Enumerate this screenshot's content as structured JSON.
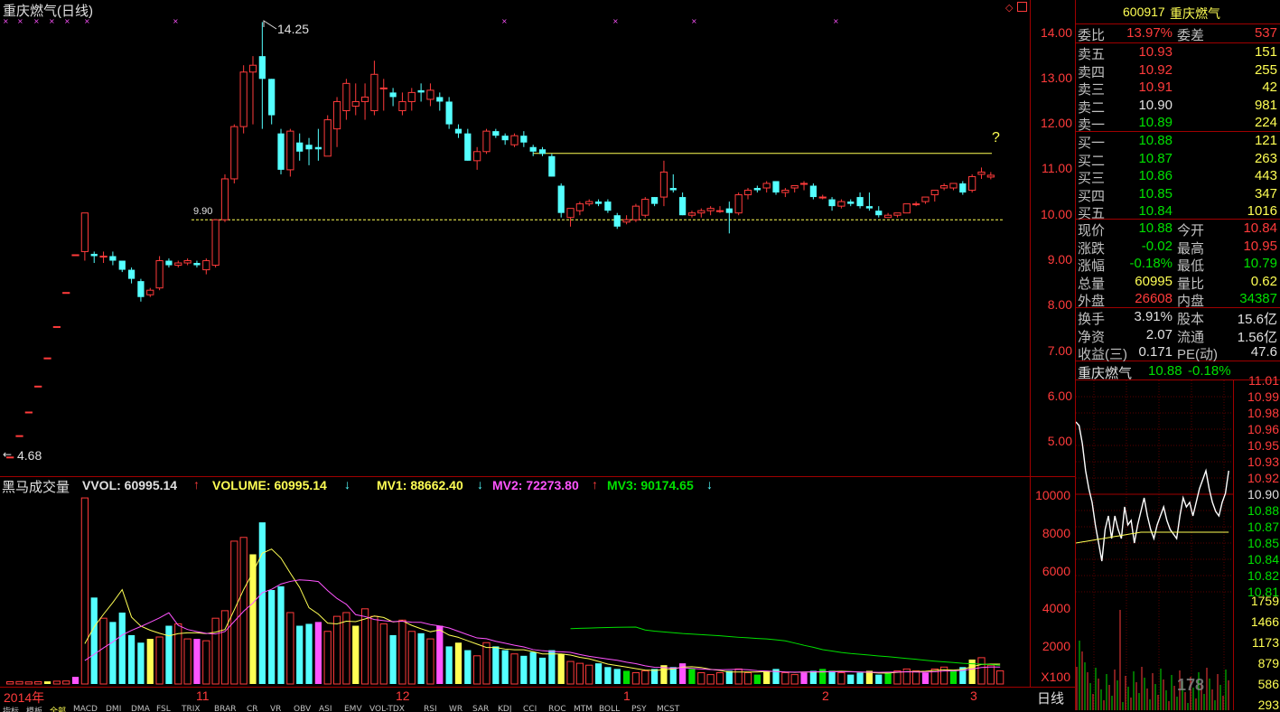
{
  "title": "重庆燃气(日线)",
  "stock": {
    "code": "600917",
    "name": "重庆燃气"
  },
  "kline_axis": [
    "14.00",
    "13.00",
    "12.00",
    "11.00",
    "10.00",
    "9.00",
    "8.00",
    "7.00",
    "6.00",
    "5.00"
  ],
  "annotations": {
    "high": "14.25",
    "low": "4.68",
    "support": "9.90",
    "question": "?"
  },
  "indicator": {
    "name": "黑马成交量",
    "vvol": "VVOL: 60995.14",
    "volume": "VOLUME: 60995.14",
    "mv1": "MV1: 88662.40",
    "mv2": "MV2: 72273.80",
    "mv3": "MV3: 90174.65",
    "arrow_up": "↑",
    "arrow_down": "↓"
  },
  "vol_axis": [
    "10000",
    "8000",
    "6000",
    "4000",
    "2000"
  ],
  "vol_unit": "X100",
  "date_axis": {
    "year": "2014年",
    "months": [
      "11",
      "12",
      "1",
      "2",
      "3"
    ],
    "period": "日线"
  },
  "bottom_tabs": [
    "指标",
    "模板",
    "全部",
    "MACD",
    "DMI",
    "DMA",
    "FSL",
    "TRIX",
    "BRAR",
    "CR",
    "VR",
    "OBV",
    "ASI",
    "EMV",
    "VOL-TDX",
    "RSI",
    "WR",
    "SAR",
    "KDJ",
    "CCI",
    "ROC",
    "MTM",
    "BOLL",
    "PSY",
    "MCST"
  ],
  "quote": {
    "weibi": {
      "label": "委比",
      "value": "13.97%",
      "label2": "委差",
      "value2": "537"
    },
    "sells": [
      {
        "label": "卖五",
        "price": "10.93",
        "vol": "151"
      },
      {
        "label": "卖四",
        "price": "10.92",
        "vol": "255"
      },
      {
        "label": "卖三",
        "price": "10.91",
        "vol": "42"
      },
      {
        "label": "卖二",
        "price": "10.90",
        "vol": "981"
      },
      {
        "label": "卖一",
        "price": "10.89",
        "vol": "224"
      }
    ],
    "buys": [
      {
        "label": "买一",
        "price": "10.88",
        "vol": "121"
      },
      {
        "label": "买二",
        "price": "10.87",
        "vol": "263"
      },
      {
        "label": "买三",
        "price": "10.86",
        "vol": "443"
      },
      {
        "label": "买四",
        "price": "10.85",
        "vol": "347"
      },
      {
        "label": "买五",
        "price": "10.84",
        "vol": "1016"
      }
    ],
    "stats": [
      {
        "l1": "现价",
        "v1": "10.88",
        "l2": "今开",
        "v2": "10.84"
      },
      {
        "l1": "涨跌",
        "v1": "-0.02",
        "l2": "最高",
        "v2": "10.95"
      },
      {
        "l1": "涨幅",
        "v1": "-0.18%",
        "l2": "最低",
        "v2": "10.79"
      },
      {
        "l1": "总量",
        "v1": "60995",
        "l2": "量比",
        "v2": "0.62"
      },
      {
        "l1": "外盘",
        "v1": "26608",
        "l2": "内盘",
        "v2": "34387"
      }
    ],
    "stats2": [
      {
        "l1": "换手",
        "v1": "3.91%",
        "l2": "股本",
        "v2": "15.6亿"
      },
      {
        "l1": "净资",
        "v1": "2.07",
        "l2": "流通",
        "v2": "1.56亿"
      },
      {
        "l1": "收益(三)",
        "v1": "0.171",
        "l2": "PE(动)",
        "v2": "47.6"
      }
    ]
  },
  "mini": {
    "name": "重庆燃气",
    "price": "10.88",
    "change": "-0.18%",
    "price_axis": [
      "11.01",
      "10.99",
      "10.98",
      "10.96",
      "10.95",
      "10.93",
      "10.92",
      "10.90",
      "10.88",
      "10.87",
      "10.85",
      "10.84",
      "10.82",
      "10.81"
    ],
    "vol_axis": [
      "1759",
      "1466",
      "1173",
      "879",
      "586",
      "293"
    ],
    "watermark": "178"
  },
  "colors": {
    "up": "#ff3b3b",
    "down": "#54ffff",
    "ma1": "#ffff54",
    "ma2": "#ff54ff",
    "ma3": "#00e000",
    "border": "#a00000"
  },
  "chart_data": {
    "type": "candlestick",
    "ylim": [
      4.5,
      14.5
    ],
    "candles": [
      [
        4.68,
        4.68,
        4.68,
        4.68
      ],
      [
        5.15,
        5.15,
        5.15,
        5.15
      ],
      [
        5.67,
        5.67,
        5.67,
        5.67
      ],
      [
        6.24,
        6.24,
        6.24,
        6.24
      ],
      [
        6.86,
        6.86,
        6.86,
        6.86
      ],
      [
        7.55,
        7.55,
        7.55,
        7.55
      ],
      [
        8.3,
        8.3,
        8.3,
        8.3
      ],
      [
        9.13,
        9.13,
        9.13,
        9.13
      ],
      [
        9.2,
        10.05,
        9.0,
        10.05
      ],
      [
        9.15,
        9.2,
        8.95,
        9.1
      ],
      [
        9.1,
        9.2,
        8.95,
        9.1
      ],
      [
        9.1,
        9.2,
        8.9,
        9.0
      ],
      [
        9.0,
        9.0,
        8.75,
        8.8
      ],
      [
        8.8,
        8.85,
        8.5,
        8.6
      ],
      [
        8.55,
        8.6,
        8.1,
        8.2
      ],
      [
        8.25,
        8.4,
        8.2,
        8.35
      ],
      [
        8.4,
        9.1,
        8.35,
        9.0
      ],
      [
        9.0,
        9.05,
        8.85,
        8.9
      ],
      [
        8.9,
        9.0,
        8.85,
        8.95
      ],
      [
        8.95,
        9.05,
        8.9,
        9.0
      ],
      [
        8.95,
        9.0,
        8.85,
        8.9
      ],
      [
        8.8,
        9.05,
        8.7,
        9.0
      ],
      [
        8.9,
        9.9,
        8.85,
        9.9
      ],
      [
        9.9,
        10.9,
        9.85,
        10.8
      ],
      [
        10.8,
        12.0,
        10.7,
        11.95
      ],
      [
        11.95,
        13.3,
        11.8,
        13.15
      ],
      [
        13.15,
        13.5,
        12.0,
        13.3
      ],
      [
        13.5,
        14.25,
        11.9,
        13.0
      ],
      [
        13.0,
        13.0,
        12.0,
        12.2
      ],
      [
        11.8,
        11.9,
        10.9,
        11.0
      ],
      [
        11.0,
        11.9,
        10.85,
        11.85
      ],
      [
        11.6,
        11.8,
        11.2,
        11.4
      ],
      [
        11.55,
        11.7,
        11.1,
        11.45
      ],
      [
        11.5,
        11.9,
        11.2,
        11.45
      ],
      [
        11.3,
        12.2,
        11.3,
        12.1
      ],
      [
        11.9,
        12.6,
        11.5,
        12.5
      ],
      [
        12.3,
        13.0,
        12.1,
        12.9
      ],
      [
        12.4,
        12.9,
        12.2,
        12.5
      ],
      [
        12.5,
        12.9,
        12.1,
        12.6
      ],
      [
        12.3,
        13.4,
        12.2,
        13.1
      ],
      [
        12.8,
        13.0,
        12.3,
        12.8
      ],
      [
        12.7,
        12.8,
        12.4,
        12.6
      ],
      [
        12.3,
        12.7,
        12.2,
        12.5
      ],
      [
        12.5,
        12.8,
        12.3,
        12.7
      ],
      [
        12.75,
        12.9,
        12.5,
        12.7
      ],
      [
        12.55,
        12.9,
        12.4,
        12.75
      ],
      [
        12.6,
        12.7,
        12.3,
        12.5
      ],
      [
        12.5,
        12.6,
        11.9,
        12.0
      ],
      [
        11.9,
        12.0,
        11.7,
        11.8
      ],
      [
        11.8,
        11.9,
        11.2,
        11.2
      ],
      [
        11.2,
        11.5,
        11.0,
        11.4
      ],
      [
        11.4,
        11.9,
        11.35,
        11.85
      ],
      [
        11.85,
        11.9,
        11.7,
        11.75
      ],
      [
        11.75,
        11.8,
        11.55,
        11.65
      ],
      [
        11.55,
        11.8,
        11.5,
        11.75
      ],
      [
        11.75,
        11.85,
        11.5,
        11.6
      ],
      [
        11.5,
        11.55,
        11.3,
        11.4
      ],
      [
        11.45,
        11.5,
        11.3,
        11.35
      ],
      [
        11.3,
        11.35,
        10.85,
        10.85
      ],
      [
        10.65,
        10.7,
        9.95,
        10.05
      ],
      [
        9.95,
        10.1,
        9.75,
        10.15
      ],
      [
        10.1,
        10.3,
        10.0,
        10.25
      ],
      [
        10.25,
        10.35,
        10.2,
        10.3
      ],
      [
        10.3,
        10.35,
        10.2,
        10.25
      ],
      [
        10.3,
        10.35,
        10.05,
        10.1
      ],
      [
        10.0,
        10.05,
        9.7,
        9.75
      ],
      [
        9.85,
        10.0,
        9.8,
        9.9
      ],
      [
        9.9,
        10.25,
        9.85,
        10.2
      ],
      [
        10.0,
        10.4,
        9.95,
        10.35
      ],
      [
        10.4,
        10.4,
        10.2,
        10.25
      ],
      [
        10.4,
        11.2,
        10.2,
        10.95
      ],
      [
        10.6,
        10.9,
        10.5,
        10.55
      ],
      [
        10.4,
        10.5,
        10.0,
        10.0
      ],
      [
        10.0,
        10.1,
        9.95,
        10.05
      ],
      [
        10.05,
        10.15,
        9.95,
        10.1
      ],
      [
        10.1,
        10.2,
        10.0,
        10.15
      ],
      [
        10.1,
        10.2,
        10.05,
        10.1
      ],
      [
        10.15,
        10.3,
        9.6,
        10.05
      ],
      [
        10.05,
        10.5,
        10.0,
        10.45
      ],
      [
        10.45,
        10.6,
        10.35,
        10.55
      ],
      [
        10.6,
        10.65,
        10.5,
        10.55
      ],
      [
        10.6,
        10.75,
        10.5,
        10.7
      ],
      [
        10.75,
        10.75,
        10.45,
        10.5
      ],
      [
        10.5,
        10.6,
        10.4,
        10.55
      ],
      [
        10.6,
        10.65,
        10.5,
        10.65
      ],
      [
        10.7,
        10.75,
        10.55,
        10.7
      ],
      [
        10.65,
        10.7,
        10.35,
        10.4
      ],
      [
        10.4,
        10.45,
        10.35,
        10.4
      ],
      [
        10.35,
        10.4,
        10.1,
        10.2
      ],
      [
        10.2,
        10.35,
        10.15,
        10.3
      ],
      [
        10.3,
        10.35,
        10.2,
        10.25
      ],
      [
        10.4,
        10.5,
        10.15,
        10.2
      ],
      [
        10.2,
        10.5,
        10.1,
        10.15
      ],
      [
        10.1,
        10.2,
        9.95,
        10.0
      ],
      [
        9.95,
        10.05,
        9.95,
        10.0
      ],
      [
        10.0,
        10.05,
        9.95,
        10.05
      ],
      [
        10.05,
        10.25,
        10.05,
        10.25
      ],
      [
        10.25,
        10.3,
        10.2,
        10.25
      ],
      [
        10.3,
        10.4,
        10.25,
        10.4
      ],
      [
        10.45,
        10.55,
        10.3,
        10.55
      ],
      [
        10.6,
        10.7,
        10.55,
        10.65
      ],
      [
        10.6,
        10.7,
        10.55,
        10.7
      ],
      [
        10.7,
        10.75,
        10.45,
        10.5
      ],
      [
        10.55,
        10.9,
        10.5,
        10.85
      ],
      [
        10.9,
        11.05,
        10.8,
        10.95
      ],
      [
        10.84,
        10.95,
        10.79,
        10.88
      ]
    ],
    "volume": [
      120,
      130,
      110,
      125,
      140,
      150,
      160,
      380,
      9900,
      4600,
      3500,
      3300,
      3800,
      2600,
      2200,
      2400,
      2500,
      3100,
      3200,
      2400,
      2400,
      2300,
      3500,
      3900,
      7600,
      7800,
      6900,
      8600,
      5000,
      5200,
      3800,
      3100,
      3200,
      3300,
      2800,
      3600,
      3800,
      3100,
      4000,
      3600,
      3200,
      2600,
      3400,
      2800,
      2700,
      2400,
      3100,
      2000,
      2200,
      1800,
      1500,
      2200,
      2000,
      1800,
      1600,
      1500,
      1700,
      1400,
      1800,
      1600,
      1200,
      1100,
      1000,
      1100,
      900,
      800,
      700,
      600,
      700,
      800,
      1000,
      900,
      1100,
      800,
      600,
      500,
      600,
      700,
      800,
      600,
      500,
      700,
      800,
      600,
      500,
      600,
      700,
      800,
      700,
      600,
      500,
      600,
      700,
      500,
      600,
      700,
      800,
      700,
      600,
      800,
      900,
      700,
      900,
      1300,
      1400,
      1000,
      700
    ]
  }
}
